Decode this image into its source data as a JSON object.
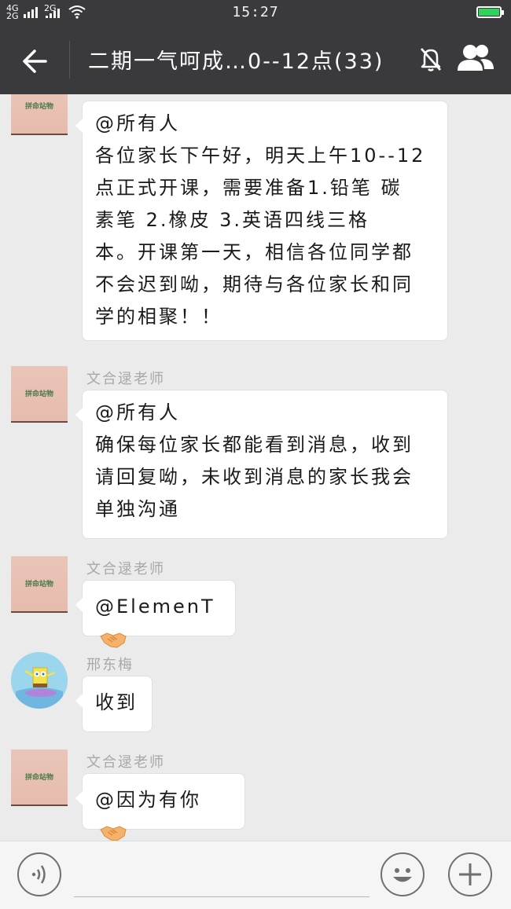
{
  "status_bar": {
    "network_top": "4G",
    "network_bottom": "2G",
    "network2": "2G",
    "time": "15:27",
    "battery_level": 1.0,
    "battery_color": "#2fd35a"
  },
  "header": {
    "title": "二期一气呵成…0--12点(33)",
    "back_icon": "back-arrow-icon",
    "mute_icon": "mute-bell-icon",
    "members_icon": "group-members-icon"
  },
  "messages": [
    {
      "sender": "",
      "avatar_text": "拼命站物",
      "text": "@所有人\n各位家长下午好，明天上午10--12点正式开课，需要准备1.铅笔  碳素笔  2.橡皮  3.英语四线三格本。开课第一天，相信各位同学都不会迟到呦，期待与各位家长和同学的相聚！！",
      "lines": [
        "@所有人",
        "各位家长下午好，明天上午10--12",
        "点正式开课，需要准备1.铅笔  碳",
        "素笔  2.橡皮  3.英语四线三格",
        "本。开课第一天，相信各位同学都",
        "不会迟到呦，期待与各位家长和同",
        "学的相聚！！"
      ]
    },
    {
      "sender": "文合逯老师",
      "avatar_text": "拼命站物",
      "lines": [
        "@所有人",
        "确保每位家长都能看到消息，收到",
        "请回复呦，未收到消息的家长我会",
        "单独沟通"
      ]
    },
    {
      "sender": "文合逯老师",
      "avatar_text": "拼命站物",
      "lines": [
        "@ElemenT"
      ],
      "emoji": "handshake-icon"
    },
    {
      "sender": "邢东梅",
      "avatar": "spongebob-avatar",
      "lines": [
        "收到"
      ]
    },
    {
      "sender": "文合逯老师",
      "avatar_text": "拼命站物",
      "lines": [
        "@因为有你"
      ],
      "emoji": "handshake-icon"
    }
  ],
  "input_bar": {
    "voice_icon": "voice-icon",
    "emoji_icon": "smiley-icon",
    "plus_icon": "plus-icon"
  }
}
